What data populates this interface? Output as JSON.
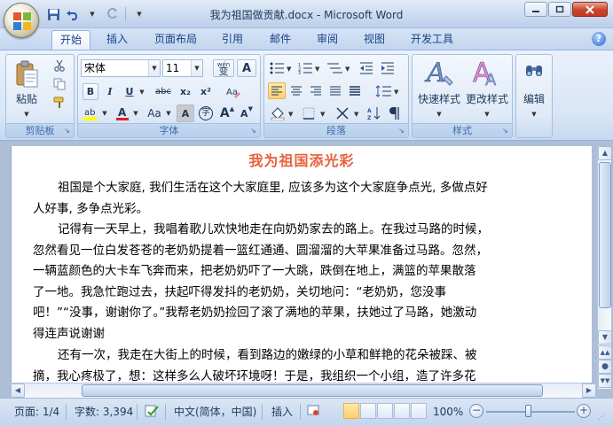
{
  "window": {
    "title": "我为祖国做贡献.docx - Microsoft Word",
    "controls": {
      "minimize": "─",
      "maximize": "□",
      "close": "✕"
    }
  },
  "quick_access": [
    "save-icon",
    "undo-icon",
    "redo-icon",
    "customize-icon"
  ],
  "tabs": [
    {
      "label": "开始",
      "active": true
    },
    {
      "label": "插入"
    },
    {
      "label": "页面布局"
    },
    {
      "label": "引用"
    },
    {
      "label": "邮件"
    },
    {
      "label": "审阅"
    },
    {
      "label": "视图"
    },
    {
      "label": "开发工具"
    }
  ],
  "help": "?",
  "ribbon": {
    "clipboard": {
      "group_label": "剪贴板",
      "paste_label": "粘贴"
    },
    "font": {
      "group_label": "字体",
      "font_name": "宋体",
      "font_size": "11",
      "wen_label": "wén",
      "wen_char": "变",
      "border_char": "A",
      "bold": "B",
      "italic": "I",
      "underline": "U",
      "strike": "abc",
      "sub": "x₂",
      "sup": "x²",
      "case": "Aa",
      "shading": "A",
      "circled": "字",
      "grow": "A",
      "shrink": "A"
    },
    "paragraph": {
      "group_label": "段落"
    },
    "styles": {
      "group_label": "样式",
      "quick_styles": "快速样式",
      "change_styles": "更改样式"
    },
    "editing": {
      "label": "编辑"
    }
  },
  "document": {
    "title": "我为祖国添光彩",
    "paragraphs": [
      [
        "祖国是个大家庭, 我们生活在这个大家庭里, 应该多为这个大家庭争点光, 多做点好",
        "人好事, 多争点光彩。"
      ],
      [
        "记得有一天早上，我唱着歌儿欢快地走在向奶奶家去的路上。在我过马路的时候，",
        "忽然看见一位白发苍苍的老奶奶提着一篮红通通、圆溜溜的大苹果准备过马路。忽然，",
        "一辆蓝颜色的大卡车飞奔而来，把老奶奶吓了一大跳，跌倒在地上，满篮的苹果散落",
        "了一地。我急忙跑过去，扶起吓得发抖的老奶奶，关切地问：“老奶奶，您没事",
        "吧！”“没事，谢谢你了。”我帮老奶奶捡回了滚了满地的苹果，扶她过了马路，她激动",
        "得连声说谢谢"
      ],
      [
        "还有一次，我走在大街上的时候，看到路边的嫩绿的小草和鲜艳的花朵被踩、被",
        "摘，我心疼极了，想：这样多么人破坏环境呀！于是，我组织一个小组，造了许多花"
      ]
    ]
  },
  "statusbar": {
    "page": "页面: 1/4",
    "words": "字数: 3,394",
    "language": "中文(简体，中国)",
    "insert_mode": "插入",
    "zoom": "100%",
    "zoom_level": 1.0
  },
  "colors": {
    "title_color": "#e8603c",
    "highlight": "#ffff00",
    "font_color": "#e02020"
  }
}
